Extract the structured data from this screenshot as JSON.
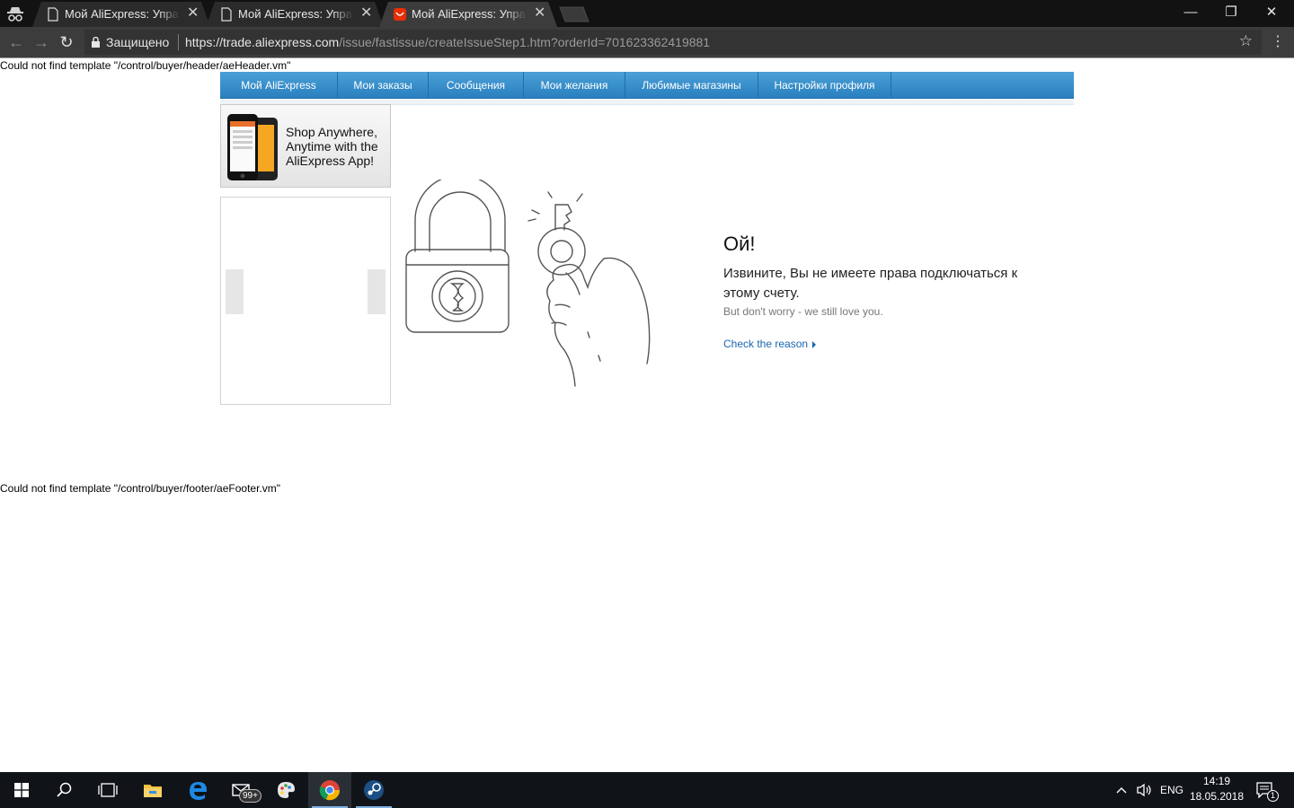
{
  "browser": {
    "tabs": [
      {
        "title": "Мой AliExpress: Управля",
        "favicon": "page-icon",
        "active": false
      },
      {
        "title": "Мой AliExpress: Управля",
        "favicon": "page-icon",
        "active": false
      },
      {
        "title": "Мой AliExpress: Управля",
        "favicon": "aliexpress-icon",
        "active": true
      }
    ],
    "close_glyph": "✕",
    "window": {
      "minimize": "—",
      "maximize": "❐",
      "close": "✕"
    },
    "toolbar": {
      "back": "←",
      "forward": "→",
      "reload": "↻",
      "secure_label": "Защищено",
      "url_host": "https://trade.aliexpress.com",
      "url_path": "/issue/fastissue/createIssueStep1.htm?orderId=701623362419881",
      "star": "☆",
      "menu": "⋮"
    }
  },
  "page": {
    "header_error": "Could not find template \"/control/buyer/header/aeHeader.vm\"",
    "footer_error": "Could not find template \"/control/buyer/footer/aeFooter.vm\"",
    "nav": [
      "Мой AliExpress",
      "Мои заказы",
      "Сообщения",
      "Мои желания",
      "Любимые магазины",
      "Настройки профиля"
    ],
    "promo": "Shop Anywhere, Anytime with the AliExpress App!",
    "error": {
      "title": "Ой!",
      "message": "Извините, Вы не имеете права подключаться к этому счету.",
      "sub": "But don't worry - we still love you.",
      "link": "Check the reason"
    }
  },
  "taskbar": {
    "badge": "99+",
    "lang": "ENG",
    "time": "14:19",
    "date": "18.05.2018",
    "notification_count": "1",
    "colors": {
      "taskbar": "#101418",
      "nav_blue": "#2a80bf",
      "link": "#1a66b3"
    }
  }
}
